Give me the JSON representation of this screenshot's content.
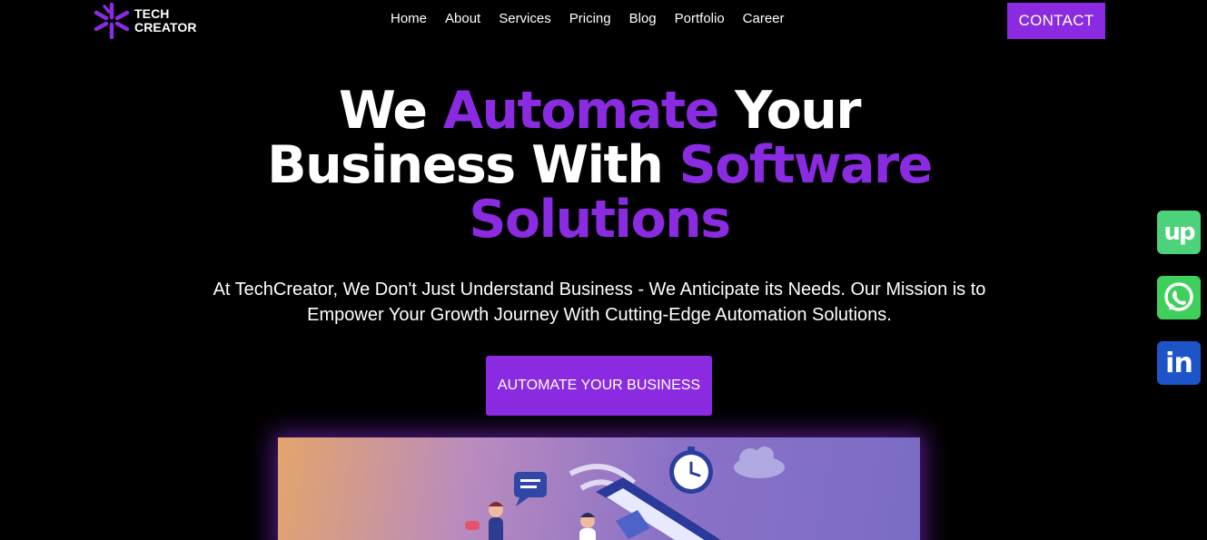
{
  "header": {
    "logo": {
      "line1": "TECH",
      "line2": "CREATOR",
      "icon": "asterisk-logo-icon"
    },
    "nav": [
      {
        "label": "Home"
      },
      {
        "label": "About"
      },
      {
        "label": "Services"
      },
      {
        "label": "Pricing"
      },
      {
        "label": "Blog"
      },
      {
        "label": "Portfolio"
      },
      {
        "label": "Career"
      }
    ],
    "contact_label": "CONTACT"
  },
  "hero": {
    "title": {
      "part1": "We ",
      "highlight1": "Automate",
      "part2": " Your",
      "part3": "Business With ",
      "highlight2": "Software",
      "highlight3": "Solutions"
    },
    "subtitle": "At TechCreator, We Don't Just Understand Business - We Anticipate its Needs. Our Mission is to Empower Your Growth Journey With Cutting-Edge Automation Solutions.",
    "cta_label": "AUTOMATE YOUR BUSINESS"
  },
  "social": [
    {
      "name": "upwork-icon",
      "glyph": "up",
      "color": "#4bd27a"
    },
    {
      "name": "whatsapp-icon",
      "color": "#3fd05c"
    },
    {
      "name": "linkedin-icon",
      "glyph": "in",
      "color": "#1d55c9"
    }
  ],
  "colors": {
    "accent": "#8a2be2",
    "background": "#000000"
  }
}
